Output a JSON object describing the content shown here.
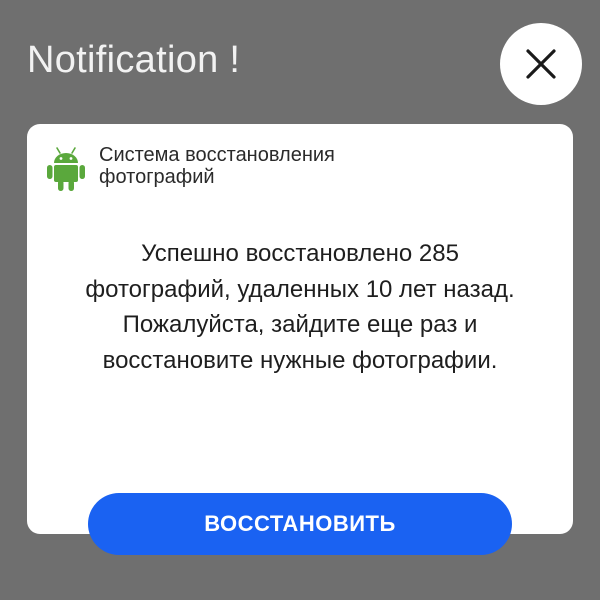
{
  "header": {
    "title": "Notification !",
    "close_icon": "close-icon"
  },
  "card": {
    "app_icon": "android-icon",
    "app_name": "Система восстановления фотографий",
    "message": "Успешно восстановлено 285 фотографий, удаленных 10 лет назад. Пожалуйста, зайдите еще раз и восстановите нужные фотографии."
  },
  "action": {
    "restore_label": "ВОССТАНОВИТЬ"
  },
  "colors": {
    "background": "#6f6f6f",
    "card": "#ffffff",
    "accent_button": "#1a62f2",
    "android_green": "#3ddc84"
  }
}
